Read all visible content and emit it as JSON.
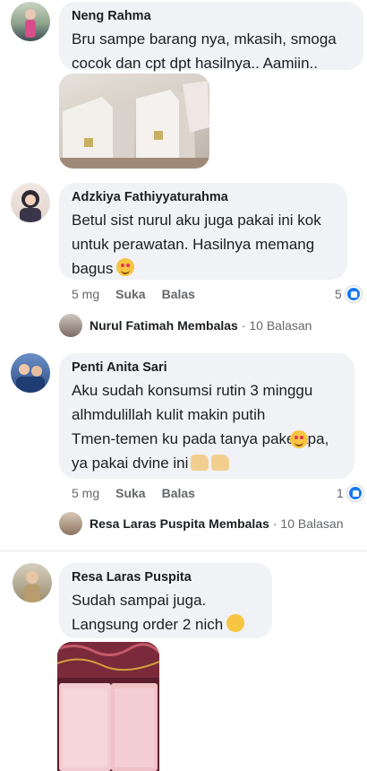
{
  "comments": [
    {
      "author": "Neng Rahma",
      "text": "Bru sampe barang nya, mkasih, smoga\ncocok dan cpt dpt hasilnya.. Aamiin.."
    },
    {
      "author": "Adzkiya Fathiyyaturahma",
      "text": "Betul sist nurul aku juga pakai ini kok\nuntuk perawatan. Hasilnya memang\nbagus",
      "time": "5 mg",
      "like_label": "Suka",
      "reply_label": "Balas",
      "reaction_count": "5",
      "reply_preview": {
        "name": "Nurul Fatimah",
        "verb": "Membalas",
        "count": "· 10 Balasan"
      }
    },
    {
      "author": "Penti Anita Sari",
      "text": "Aku sudah konsumsi rutin 3 minggu\nalhmdulillah kulit makin putih\nTmen-temen ku pada tanya pake apa,\nya pakai dvine ini",
      "time": "5 mg",
      "like_label": "Suka",
      "reply_label": "Balas",
      "reaction_count": "1",
      "reply_preview": {
        "name": "Resa Laras Puspita",
        "verb": "Membalas",
        "count": "· 10 Balasan"
      }
    },
    {
      "author": "Resa Laras Puspita",
      "text": "Sudah sampai juga.\nLangsung order 2 nich"
    }
  ],
  "icons": {
    "reaction": "like-icon",
    "emoji_love": "smiling-face-with-hearts-icon",
    "emoji_thumbs": "thumbs-up-icon",
    "emoji_grin": "grinning-face-icon"
  },
  "colors": {
    "bubble": "#f0f2f5",
    "like_blue": "#1877f2",
    "meta": "#65676b"
  }
}
